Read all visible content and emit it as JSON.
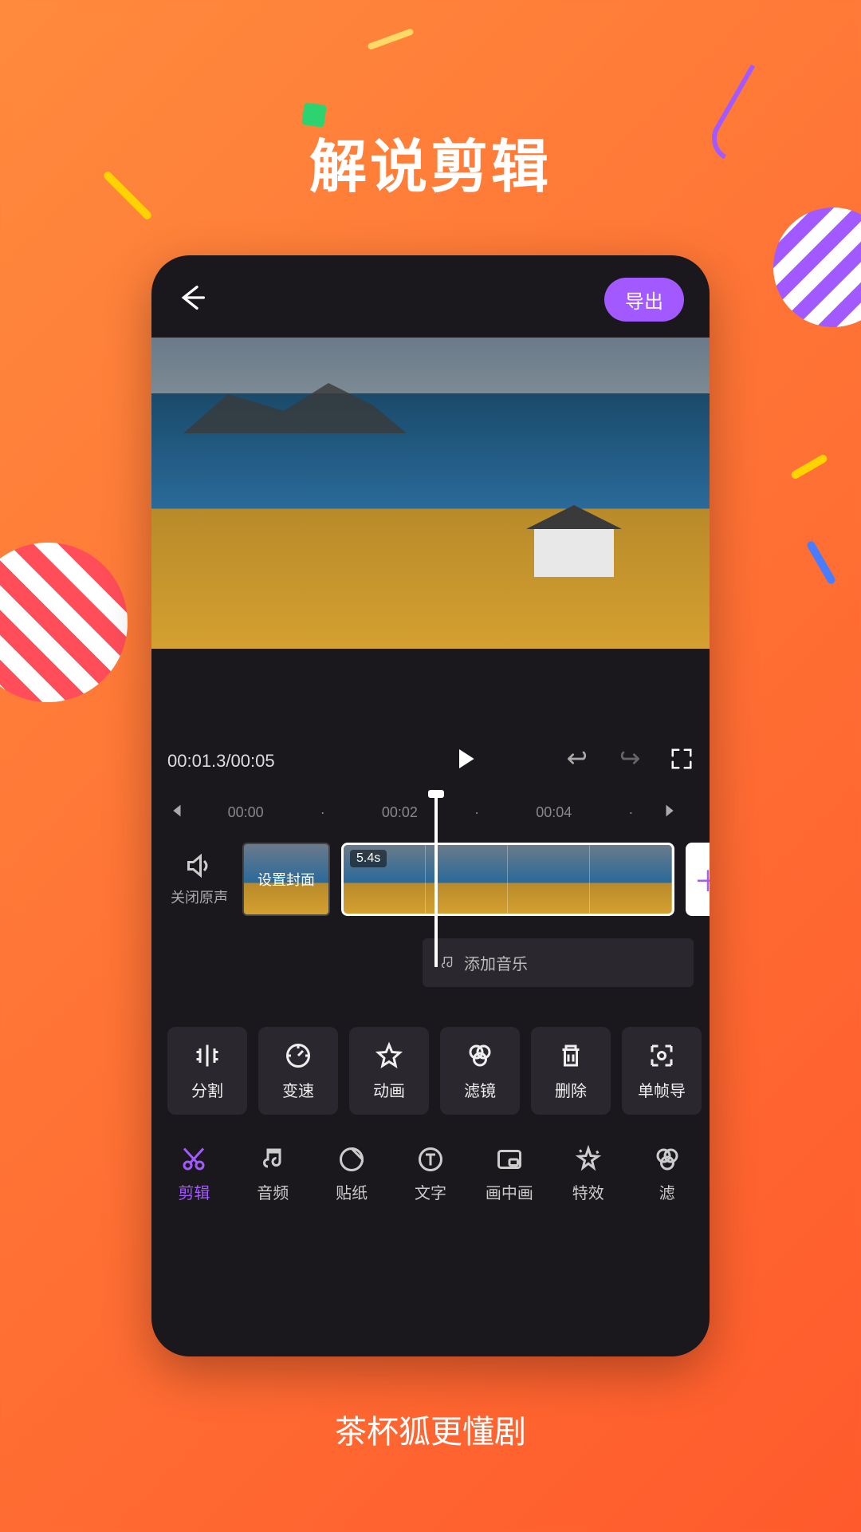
{
  "page": {
    "title": "解说剪辑",
    "tagline": "茶杯狐更懂剧"
  },
  "editor": {
    "export_label": "导出",
    "time_current": "00:01.3",
    "time_total": "00:05",
    "ruler": {
      "t0": "00:00",
      "t1": "00:02",
      "t2": "00:04"
    },
    "timeline": {
      "mute_label": "关闭原声",
      "set_cover_label": "设置封面",
      "clip_duration": "5.4s",
      "add_label": "添",
      "add_music_label": "添加音乐"
    },
    "tools": [
      {
        "id": "split",
        "label": "分割"
      },
      {
        "id": "speed",
        "label": "变速"
      },
      {
        "id": "anim",
        "label": "动画"
      },
      {
        "id": "filter",
        "label": "滤镜"
      },
      {
        "id": "delete",
        "label": "删除"
      },
      {
        "id": "frame_export",
        "label": "单帧导"
      }
    ],
    "tabs": [
      {
        "id": "edit",
        "label": "剪辑",
        "active": true
      },
      {
        "id": "audio",
        "label": "音频"
      },
      {
        "id": "sticker",
        "label": "贴纸"
      },
      {
        "id": "text",
        "label": "文字"
      },
      {
        "id": "pip",
        "label": "画中画"
      },
      {
        "id": "effect",
        "label": "特效"
      },
      {
        "id": "filter2",
        "label": "滤"
      }
    ]
  }
}
